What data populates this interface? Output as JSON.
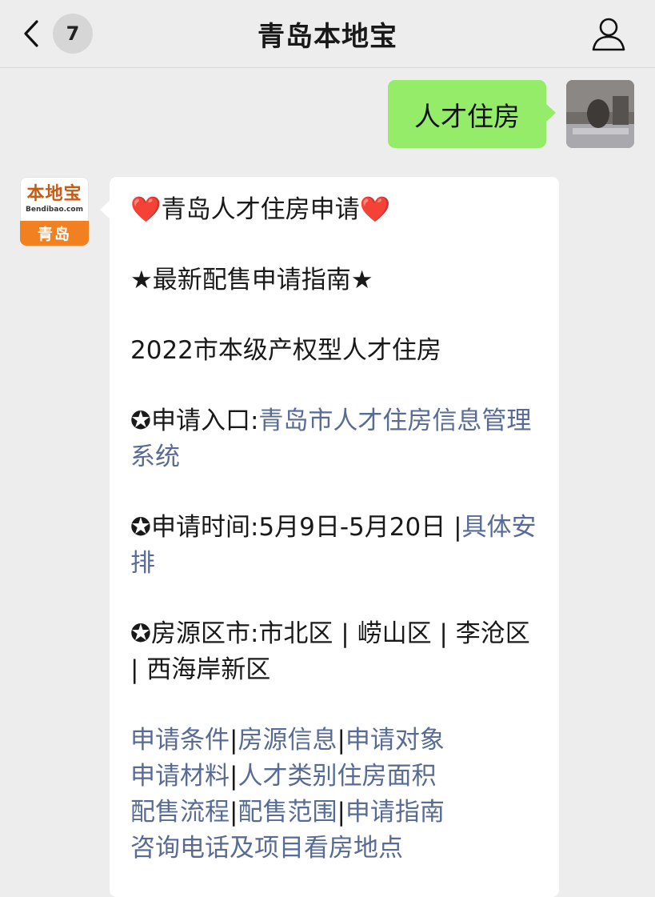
{
  "navbar": {
    "back_badge": "7",
    "title": "青岛本地宝",
    "back_icon": "chevron-left-icon",
    "profile_icon": "person-icon"
  },
  "user_message": {
    "text": "人才住房"
  },
  "bot": {
    "avatar_main": "本地宝",
    "avatar_sub": "Bendibao.com",
    "avatar_city": "青岛",
    "heading_prefix_icon": "❤️",
    "heading": "青岛人才住房申请",
    "heading_suffix_icon": "❤️",
    "guide": "★最新配售申请指南★",
    "year_line": "2022市本级产权型人才住房",
    "entry_label": "✪申请入口:",
    "entry_link": "青岛市人才住房信息管理系统",
    "time_label": "✪申请时间:5月9日-5月20日 |",
    "time_link": "具体安排",
    "area_line": "✪房源区市:市北区 | 崂山区 | 李沧区 | 西海岸新区",
    "links": [
      {
        "label": "申请条件"
      },
      {
        "label": "房源信息"
      },
      {
        "label": "申请对象"
      },
      {
        "label": "申请材料"
      },
      {
        "label": "人才类别住房面积"
      },
      {
        "label": "配售流程"
      },
      {
        "label": "配售范围"
      },
      {
        "label": "申请指南"
      },
      {
        "label": "咨询电话及项目看房地点"
      }
    ],
    "separator": "|"
  },
  "colors": {
    "background": "#ededed",
    "user_bubble": "#95ec69",
    "bot_bubble": "#ffffff",
    "link": "#576b95",
    "brand_orange": "#f08020"
  }
}
